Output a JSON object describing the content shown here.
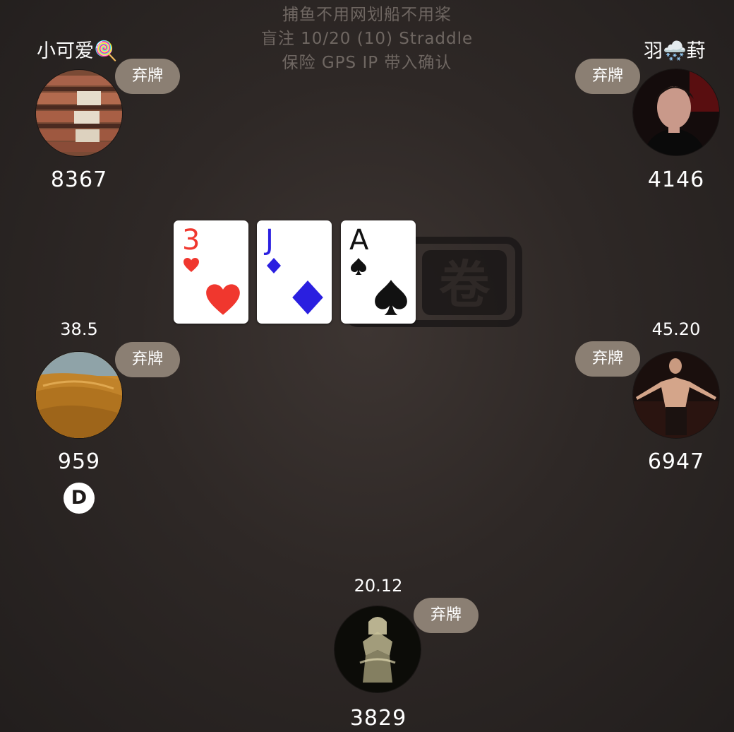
{
  "table": {
    "line1": "捕鱼不用网划船不用桨",
    "line2": "盲注 10/20 (10) Straddle",
    "line3": "保险 GPS IP 带入确认"
  },
  "watermark": {
    "glyph": "卷"
  },
  "board": {
    "cards": [
      {
        "rank": "3",
        "suit": "hearts",
        "color": "#f0372e"
      },
      {
        "rank": "J",
        "suit": "diamonds",
        "color": "#2a1fe0"
      },
      {
        "rank": "A",
        "suit": "spades",
        "color": "#111111"
      }
    ]
  },
  "players": {
    "top_left": {
      "name": "小可爱🍭",
      "stack": "8367",
      "action": "弃牌"
    },
    "top_right": {
      "name": "羽🌨️葑",
      "stack": "4146",
      "action": "弃牌"
    },
    "mid_left": {
      "bet": "38.5",
      "stack": "959",
      "action": "弃牌",
      "dealer": "D"
    },
    "mid_right": {
      "bet": "45.20",
      "stack": "6947",
      "action": "弃牌"
    },
    "bottom": {
      "bet": "20.12",
      "stack": "3829",
      "action": "弃牌"
    }
  },
  "colors": {
    "fold_badge": "#8b7f73",
    "background": "#2e2826"
  }
}
